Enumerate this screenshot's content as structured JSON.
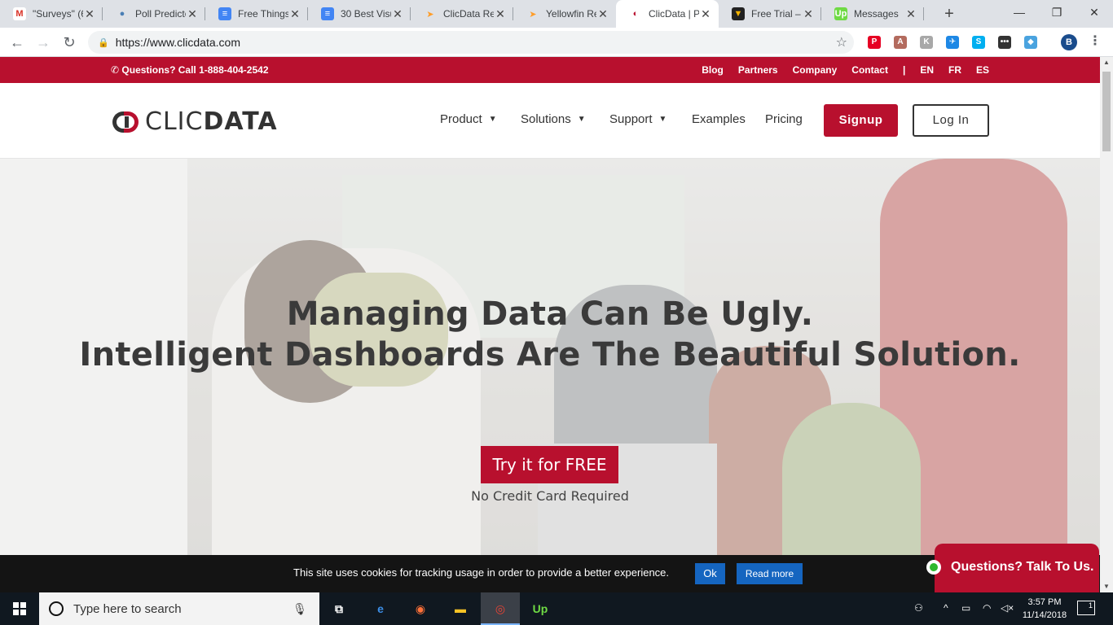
{
  "browser": {
    "tabs": [
      {
        "title": "\"Surveys\" (6",
        "favicon": "gmail-icon",
        "glyph": "M",
        "color": "#d93025",
        "bg": "#ffffff"
      },
      {
        "title": "Poll Predicto",
        "favicon": "globe-icon",
        "glyph": "●",
        "color": "#4a7fb5",
        "bg": "transparent"
      },
      {
        "title": "Free Things",
        "favicon": "docs-icon",
        "glyph": "≡",
        "color": "#ffffff",
        "bg": "#4285f4"
      },
      {
        "title": "30 Best Visu",
        "favicon": "docs-icon",
        "glyph": "≡",
        "color": "#ffffff",
        "bg": "#4285f4"
      },
      {
        "title": "ClicData Re",
        "favicon": "capterra-icon",
        "glyph": "➤",
        "color": "#ff9d28",
        "bg": "transparent"
      },
      {
        "title": "Yellowfin Re",
        "favicon": "capterra-icon",
        "glyph": "➤",
        "color": "#ff9d28",
        "bg": "transparent"
      },
      {
        "title": "ClicData | P",
        "favicon": "clicdata-icon",
        "glyph": "◐",
        "color": "#b8102e",
        "bg": "transparent"
      },
      {
        "title": "Free Trial –",
        "favicon": "shield-icon",
        "glyph": "▼",
        "color": "#f5b400",
        "bg": "#222222"
      },
      {
        "title": "Messages",
        "favicon": "upwork-icon",
        "glyph": "Up",
        "color": "#ffffff",
        "bg": "#6fda44"
      }
    ],
    "close_glyph": "✕",
    "new_tab_glyph": "+",
    "window_controls": {
      "minimize": "—",
      "maximize": "❐",
      "close": "✕"
    },
    "nav": {
      "back": "←",
      "forward": "→",
      "reload": "↻"
    },
    "url": "https://www.clicdata.com",
    "lock_glyph": "🔒",
    "star_glyph": "☆",
    "extensions": [
      {
        "name": "pinterest-icon",
        "glyph": "P",
        "color": "#e60023"
      },
      {
        "name": "pdf-icon",
        "glyph": "A",
        "color": "#b36b5e"
      },
      {
        "name": "grammar-icon",
        "glyph": "K",
        "color": "#a8a8a8"
      },
      {
        "name": "flame-icon",
        "glyph": "✈",
        "color": "#1e88e5"
      },
      {
        "name": "skype-icon",
        "glyph": "S",
        "color": "#00aff0"
      },
      {
        "name": "dots-extension-icon",
        "glyph": "•••",
        "color": "#333333"
      },
      {
        "name": "diamond-extension-icon",
        "glyph": "◆",
        "color": "#4aa3df"
      }
    ],
    "profile_initial": "B",
    "menu_glyph": "⋮"
  },
  "site": {
    "topbar": {
      "phone": "Questions? Call 1-888-404-2542",
      "phone_glyph": "✆",
      "links": [
        "Blog",
        "Partners",
        "Company",
        "Contact",
        "|",
        "EN",
        "FR",
        "ES"
      ]
    },
    "logo": {
      "part1": "CLIC",
      "part2": "DATA"
    },
    "nav": [
      {
        "label": "Product",
        "dropdown": true
      },
      {
        "label": "Solutions",
        "dropdown": true
      },
      {
        "label": "Support",
        "dropdown": true
      },
      {
        "label": "Examples",
        "dropdown": false
      },
      {
        "label": "Pricing",
        "dropdown": false
      }
    ],
    "chevron": "⌄",
    "signup": "Signup",
    "login": "Log In",
    "hero": {
      "line1": "Managing Data Can Be Ugly.",
      "line2": "Intelligent Dashboards Are The Beautiful Solution.",
      "cta": "Try it for FREE",
      "note": "No Credit Card Required"
    },
    "cookie": {
      "message": "This site uses cookies for tracking usage in order to provide a better experience.",
      "ok": "Ok",
      "read_more": "Read more"
    },
    "chat": "Questions? Talk To Us."
  },
  "taskbar": {
    "search_placeholder": "Type here to search",
    "mic_glyph": "🎙",
    "apps": [
      {
        "name": "task-view-icon",
        "glyph": "⧉",
        "color": "#ffffff"
      },
      {
        "name": "edge-icon",
        "glyph": "e",
        "color": "#3c8ee6"
      },
      {
        "name": "firefox-icon",
        "glyph": "◉",
        "color": "#ff7139"
      },
      {
        "name": "file-explorer-icon",
        "glyph": "▬",
        "color": "#f7c325"
      },
      {
        "name": "chrome-icon",
        "glyph": "◎",
        "color": "#ea4335"
      },
      {
        "name": "upwork-icon",
        "glyph": "Up",
        "color": "#6fda44"
      }
    ],
    "tray": [
      {
        "name": "people-icon",
        "glyph": "⚇"
      },
      {
        "name": "chevron-up-icon",
        "glyph": "^"
      },
      {
        "name": "battery-icon",
        "glyph": "▭"
      },
      {
        "name": "wifi-icon",
        "glyph": "◠"
      },
      {
        "name": "volume-muted-icon",
        "glyph": "◁×"
      }
    ],
    "time": "3:57 PM",
    "date": "11/14/2018",
    "notif_count": "1"
  }
}
